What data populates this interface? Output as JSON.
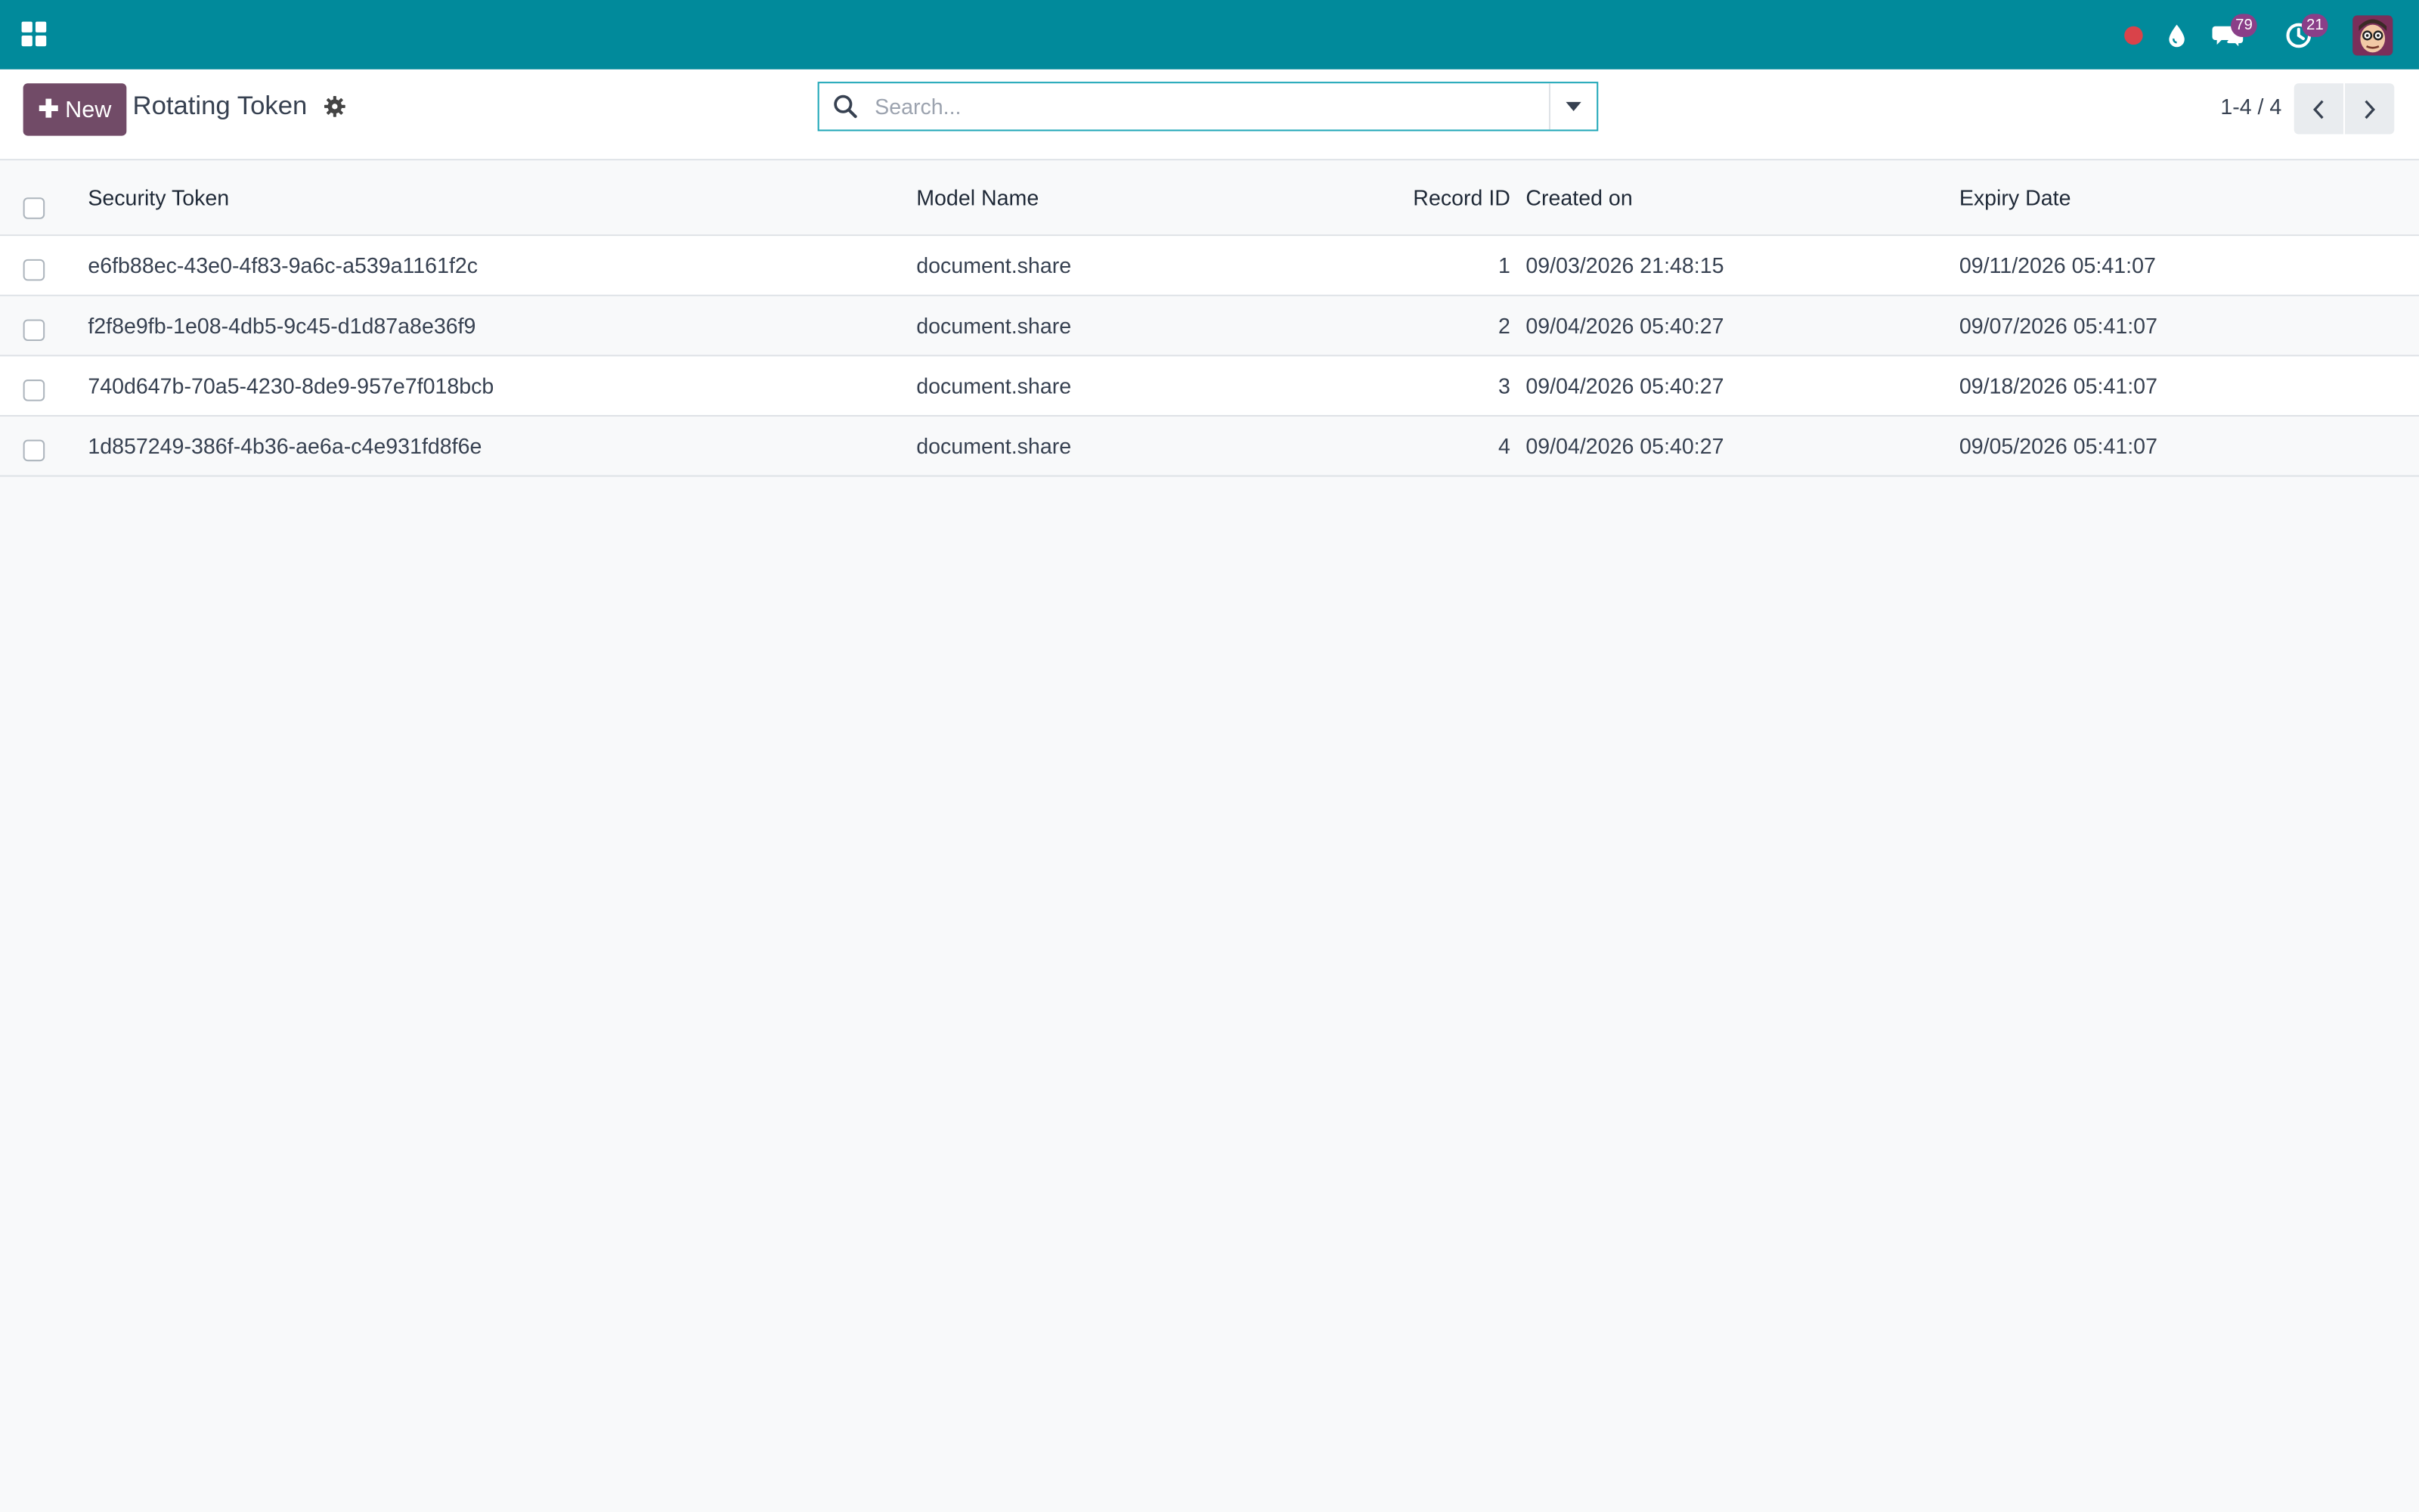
{
  "colors": {
    "navbar": "#018a9b",
    "primary_button": "#714b67",
    "badge": "#8a3f88",
    "record_dot": "#d9434a",
    "search_border": "#20a7b8"
  },
  "navbar": {
    "apps_icon": "grid-icon",
    "icons": [
      "record-dot-icon",
      "droplet-icon",
      "chat-icon",
      "clock-icon",
      "avatar"
    ],
    "messages_badge": "79",
    "activities_badge": "21"
  },
  "control_panel": {
    "new_button_label": "New",
    "title": "Rotating Token",
    "search_placeholder": "Search...",
    "pager": "1-4 / 4"
  },
  "table": {
    "columns": {
      "token": "Security Token",
      "model": "Model Name",
      "record_id": "Record ID",
      "created": "Created on",
      "expiry": "Expiry Date"
    },
    "rows": [
      {
        "token": "e6fb88ec-43e0-4f83-9a6c-a539a1161f2c",
        "model": "document.share",
        "record_id": "1",
        "created": "09/03/2026 21:48:15",
        "expiry": "09/11/2026 05:41:07"
      },
      {
        "token": "f2f8e9fb-1e08-4db5-9c45-d1d87a8e36f9",
        "model": "document.share",
        "record_id": "2",
        "created": "09/04/2026 05:40:27",
        "expiry": "09/07/2026 05:41:07"
      },
      {
        "token": "740d647b-70a5-4230-8de9-957e7f018bcb",
        "model": "document.share",
        "record_id": "3",
        "created": "09/04/2026 05:40:27",
        "expiry": "09/18/2026 05:41:07"
      },
      {
        "token": "1d857249-386f-4b36-ae6a-c4e931fd8f6e",
        "model": "document.share",
        "record_id": "4",
        "created": "09/04/2026 05:40:27",
        "expiry": "09/05/2026 05:41:07"
      }
    ]
  }
}
